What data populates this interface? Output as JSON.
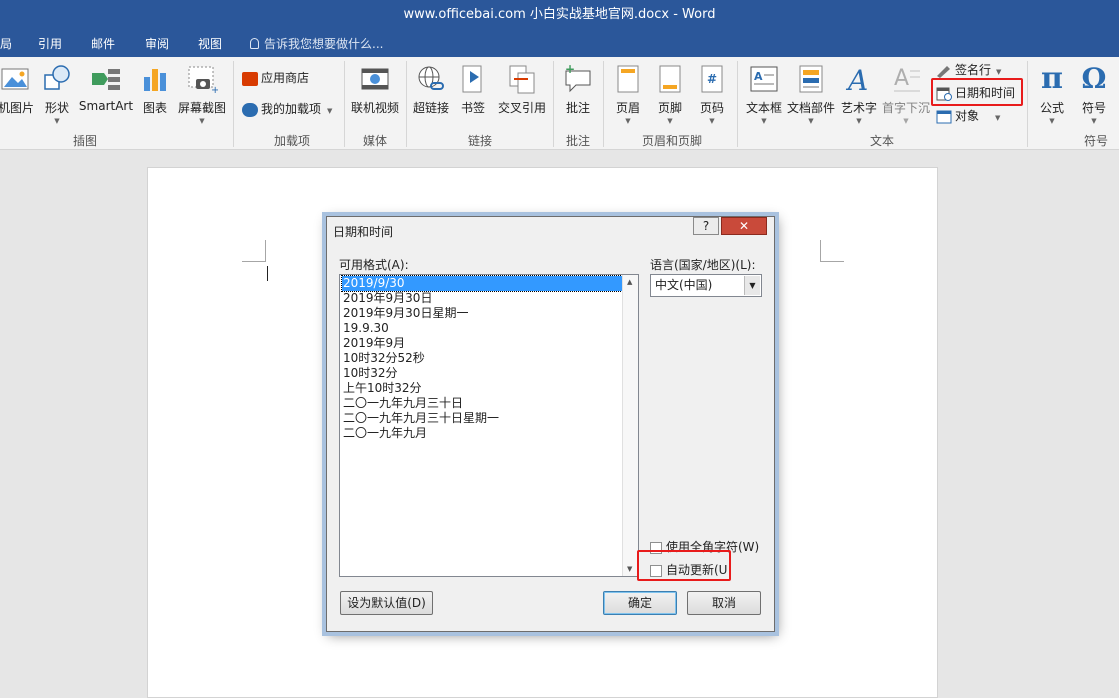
{
  "window": {
    "title": "www.officebai.com 小白实战基地官网.docx - Word"
  },
  "tabs": [
    "局",
    "引用",
    "邮件",
    "审阅",
    "视图"
  ],
  "tell_me": "告诉我您想要做什么...",
  "ribbon": {
    "groups": {
      "illustrations": "插图",
      "addins": "加载项",
      "media": "媒体",
      "links": "链接",
      "comments": "批注",
      "header_footer": "页眉和页脚",
      "text": "文本",
      "symbols": "符号"
    },
    "buttons": {
      "online_pictures": "机图片",
      "shapes": "形状",
      "smartart": "SmartArt",
      "chart": "图表",
      "screenshot": "屏幕截图",
      "store": "应用商店",
      "my_addins": "我的加载项",
      "online_video": "联机视频",
      "hyperlink": "超链接",
      "bookmark": "书签",
      "cross_ref": "交叉引用",
      "comment": "批注",
      "header": "页眉",
      "footer": "页脚",
      "page_number": "页码",
      "textbox": "文本框",
      "quick_parts": "文档部件",
      "wordart": "艺术字",
      "dropcap": "首字下沉",
      "signature_line": "签名行",
      "date_time": "日期和时间",
      "object": "对象",
      "equation": "公式",
      "symbol": "符号"
    },
    "pi_glyph": "π",
    "omega_glyph": "Ω"
  },
  "dialog": {
    "title": "日期和时间",
    "help": "?",
    "close": "✕",
    "formats_label": "可用格式(A):",
    "formats": [
      "2019/9/30",
      "2019年9月30日",
      "2019年9月30日星期一",
      "19.9.30",
      "2019年9月",
      "10时32分52秒",
      "10时32分",
      "上午10时32分",
      "二〇一九年九月三十日",
      "二〇一九年九月三十日星期一",
      "二〇一九年九月"
    ],
    "language_label": "语言(国家/地区)(L):",
    "language_value": "中文(中国)",
    "fullwidth_label": "使用全角字符(W)",
    "autoupdate_label": "自动更新(U",
    "set_default": "设为默认值(D)",
    "ok": "确定",
    "cancel": "取消"
  },
  "colors": {
    "accent": "#2b579a",
    "highlight": "#e81b1b",
    "selection": "#3399ff"
  }
}
